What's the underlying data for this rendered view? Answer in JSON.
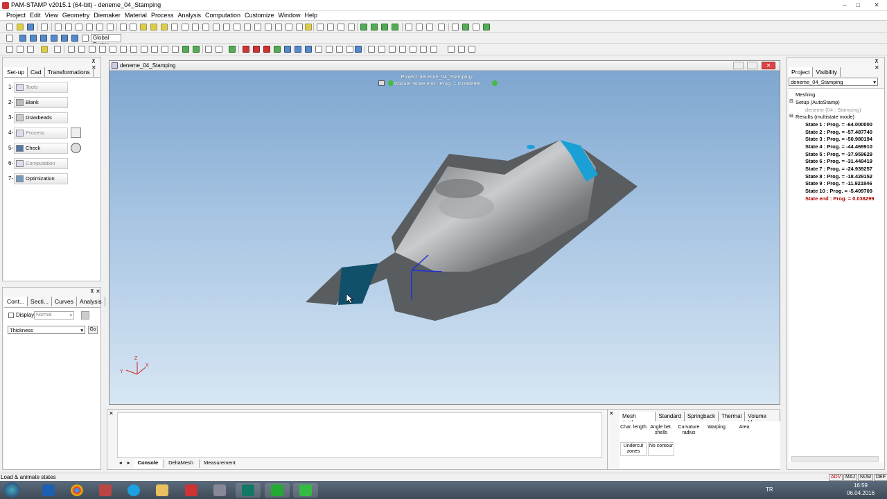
{
  "window": {
    "title": "PAM-STAMP v2015.1 (64-bit) - deneme_04_Stamping",
    "controls": [
      "–",
      "□",
      "✕"
    ]
  },
  "menu": [
    "Project",
    "Edit",
    "View",
    "Geometry",
    "Diemaker",
    "Material",
    "Process",
    "Analysis",
    "Computation",
    "Customize",
    "Window",
    "Help"
  ],
  "toolbar": {
    "coord_system": "Global Syster"
  },
  "left_panel": {
    "tabs": [
      "Set-up",
      "Cad",
      "Transformations"
    ],
    "steps": [
      {
        "num": "1-",
        "label": "Tools",
        "enabled": false
      },
      {
        "num": "2-",
        "label": "Blank",
        "enabled": true
      },
      {
        "num": "3-",
        "label": "Drawbeads",
        "enabled": true
      },
      {
        "num": "4-",
        "label": "Process",
        "enabled": false
      },
      {
        "num": "5-",
        "label": "Check",
        "enabled": true
      },
      {
        "num": "6-",
        "label": "Computation",
        "enabled": false
      },
      {
        "num": "7-",
        "label": "Optimization",
        "enabled": true
      }
    ]
  },
  "left_bottom_panel": {
    "tabs": [
      "Cont...",
      "Secti...",
      "Curves",
      "Analysis"
    ],
    "display_label": "Display",
    "display_mode": "Normal",
    "contour_field": "Thickness",
    "go_label": "Go"
  },
  "viewport": {
    "title": "deneme_04_Stamping",
    "overlay_line1": "Project 'deneme_04_Stamping'",
    "overlay_line2": "Module 'State end : Prog. = 0.038299'",
    "axis_labels": {
      "x": "X",
      "y": "Y",
      "z": "Z"
    }
  },
  "right_panel": {
    "tabs": [
      "Project",
      "Visibility"
    ],
    "project_select": "deneme_04_Stamping",
    "tree": {
      "meshing": "Meshing",
      "setup": "Setup (AutoStamp)",
      "setup_child": "deneme (04 : Stamping)",
      "results": "Results (multistate mode)",
      "states": [
        "State 1 : Prog. = -64.000000",
        "State 2 : Prog. = -57.487740",
        "State 3 : Prog. = -50.980194",
        "State 4 : Prog. = -44.469910",
        "State 5 : Prog. = -37.959629",
        "State 6 : Prog. = -31.449419",
        "State 7 : Prog. = -24.939257",
        "State 8 : Prog. = -18.429152",
        "State 9 : Prog. = -11.921846",
        "State 10 : Prog. = -5.409709",
        "State end : Prog. = 0.038299"
      ]
    }
  },
  "console": {
    "tabs": [
      "Console",
      "DeltaMesh",
      "Measurement"
    ]
  },
  "results_panel": {
    "tabs": [
      "Mesh qual...",
      "Standard",
      "Springback",
      "Thermal",
      "Volume bl..."
    ],
    "buttons": [
      [
        "Char. length",
        "Angle bet. shells",
        "Curvature radius",
        "Warping",
        "Area"
      ],
      [
        "Undercut zones",
        "No contour"
      ]
    ]
  },
  "status": {
    "message": "Load & animate states",
    "indicators": [
      "ADV",
      "MAJ",
      "NUM",
      "DEF"
    ]
  },
  "taskbar": {
    "lang": "TR",
    "time": "16:59",
    "date": "06.04.2016"
  }
}
